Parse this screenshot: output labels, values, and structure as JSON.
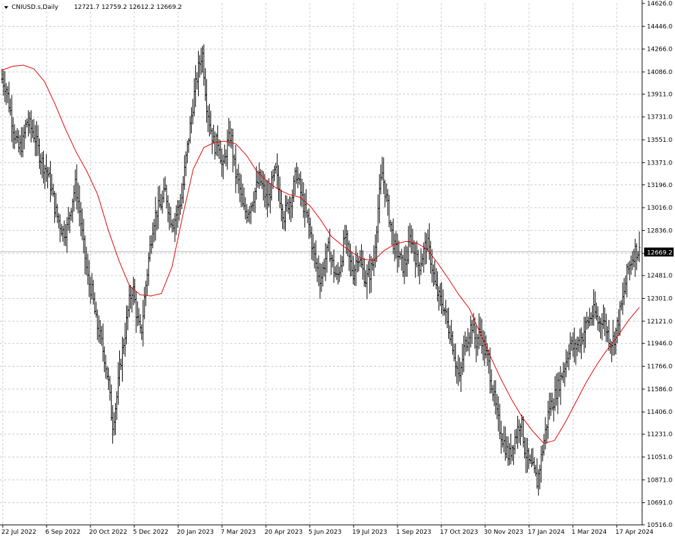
{
  "header": {
    "symbol": "CNIUSD.s,Daily",
    "ohlc": "12721.7 12759.2 12612.2 12669.2"
  },
  "price_tag": "12669.2",
  "colors": {
    "background": "#ffffff",
    "bars": "#000000",
    "ma_line": "#e00000",
    "grid": "#c8c8c8",
    "price_line": "#b4b4b4"
  },
  "chart_data": {
    "type": "line",
    "title": "CNIUSD.s,Daily",
    "y_ticks": [
      "14626.0",
      "14446.0",
      "14266.0",
      "14086.0",
      "13911.0",
      "13731.0",
      "13551.0",
      "13371.0",
      "13196.0",
      "13016.0",
      "12836.0",
      "12656.0",
      "12481.0",
      "12301.0",
      "12121.0",
      "11946.0",
      "11766.0",
      "11586.0",
      "11406.0",
      "11231.0",
      "11051.0",
      "10871.0",
      "10691.0",
      "10516.0"
    ],
    "x_ticks": [
      "22 Jul 2022",
      "6 Sep 2022",
      "20 Oct 2022",
      "5 Dec 2022",
      "20 Jan 2023",
      "7 Mar 2023",
      "20 Apr 2023",
      "5 Jun 2023",
      "19 Jul 2023",
      "1 Sep 2023",
      "17 Oct 2023",
      "30 Nov 2023",
      "17 Jan 2024",
      "1 Mar 2024",
      "17 Apr 2024"
    ],
    "ylim": [
      10516,
      14626
    ],
    "last_price": 12669.2,
    "grid": true,
    "series": [
      {
        "values": [
          14030,
          13960,
          13780,
          13600,
          13480,
          13520,
          13700,
          13650,
          13580,
          13450,
          13360,
          13300,
          13180,
          13000,
          12900,
          12820,
          12860,
          13050,
          13200,
          12980,
          12700,
          12450,
          12350,
          12120,
          12000,
          11850,
          11650,
          11300,
          11500,
          11800,
          12000,
          12250,
          12400,
          12150,
          12000,
          12350,
          12650,
          12900,
          13000,
          13050,
          13150,
          12950,
          12900,
          13000,
          13100,
          13400,
          13650,
          13900,
          14100,
          14250,
          13850,
          13650,
          13500,
          13550,
          13300,
          13500,
          13600,
          13300,
          13200,
          13000,
          12980,
          13050,
          13150,
          13250,
          13150,
          13050,
          13200,
          13300,
          13100,
          12950,
          13050,
          13100,
          13300,
          13150,
          13000,
          12900,
          12700,
          12550,
          12450,
          12600,
          12700,
          12550,
          12450,
          12600,
          12800,
          12600,
          12500,
          12650,
          12550,
          12450,
          12500,
          12600,
          13000,
          13300,
          13100,
          12900,
          12700,
          12650,
          12550,
          12600,
          12800,
          12650,
          12550,
          12650,
          12750,
          12600,
          12400,
          12300,
          12250,
          12100,
          12000,
          11800,
          11650,
          11900,
          12000,
          12100,
          11950,
          12050,
          11900,
          11800,
          11600,
          11400,
          11250,
          11150,
          11050,
          11150,
          11250,
          11350,
          11100,
          11000,
          10950,
          10850,
          11050,
          11250,
          11450,
          11500,
          11600,
          11700,
          11800,
          11950,
          11900,
          11950,
          12000,
          12100,
          12150,
          12200,
          12100,
          12150,
          12050,
          11950,
          12000,
          12150,
          12300,
          12500,
          12600,
          12680,
          12669
        ]
      },
      {
        "values": [
          14100,
          14130,
          14140,
          14110,
          14010,
          13830,
          13630,
          13450,
          13300,
          13120,
          12840,
          12600,
          12400,
          12330,
          12320,
          12340,
          12550,
          12950,
          13320,
          13490,
          13530,
          13540,
          13520,
          13430,
          13300,
          13220,
          13160,
          13120,
          13100,
          13030,
          12920,
          12790,
          12720,
          12660,
          12610,
          12600,
          12680,
          12730,
          12750,
          12740,
          12690,
          12580,
          12460,
          12330,
          12220,
          12030,
          11840,
          11660,
          11500,
          11360,
          11250,
          11160,
          11180,
          11320,
          11480,
          11640,
          11780,
          11900,
          12010,
          12130,
          12230
        ]
      }
    ]
  }
}
